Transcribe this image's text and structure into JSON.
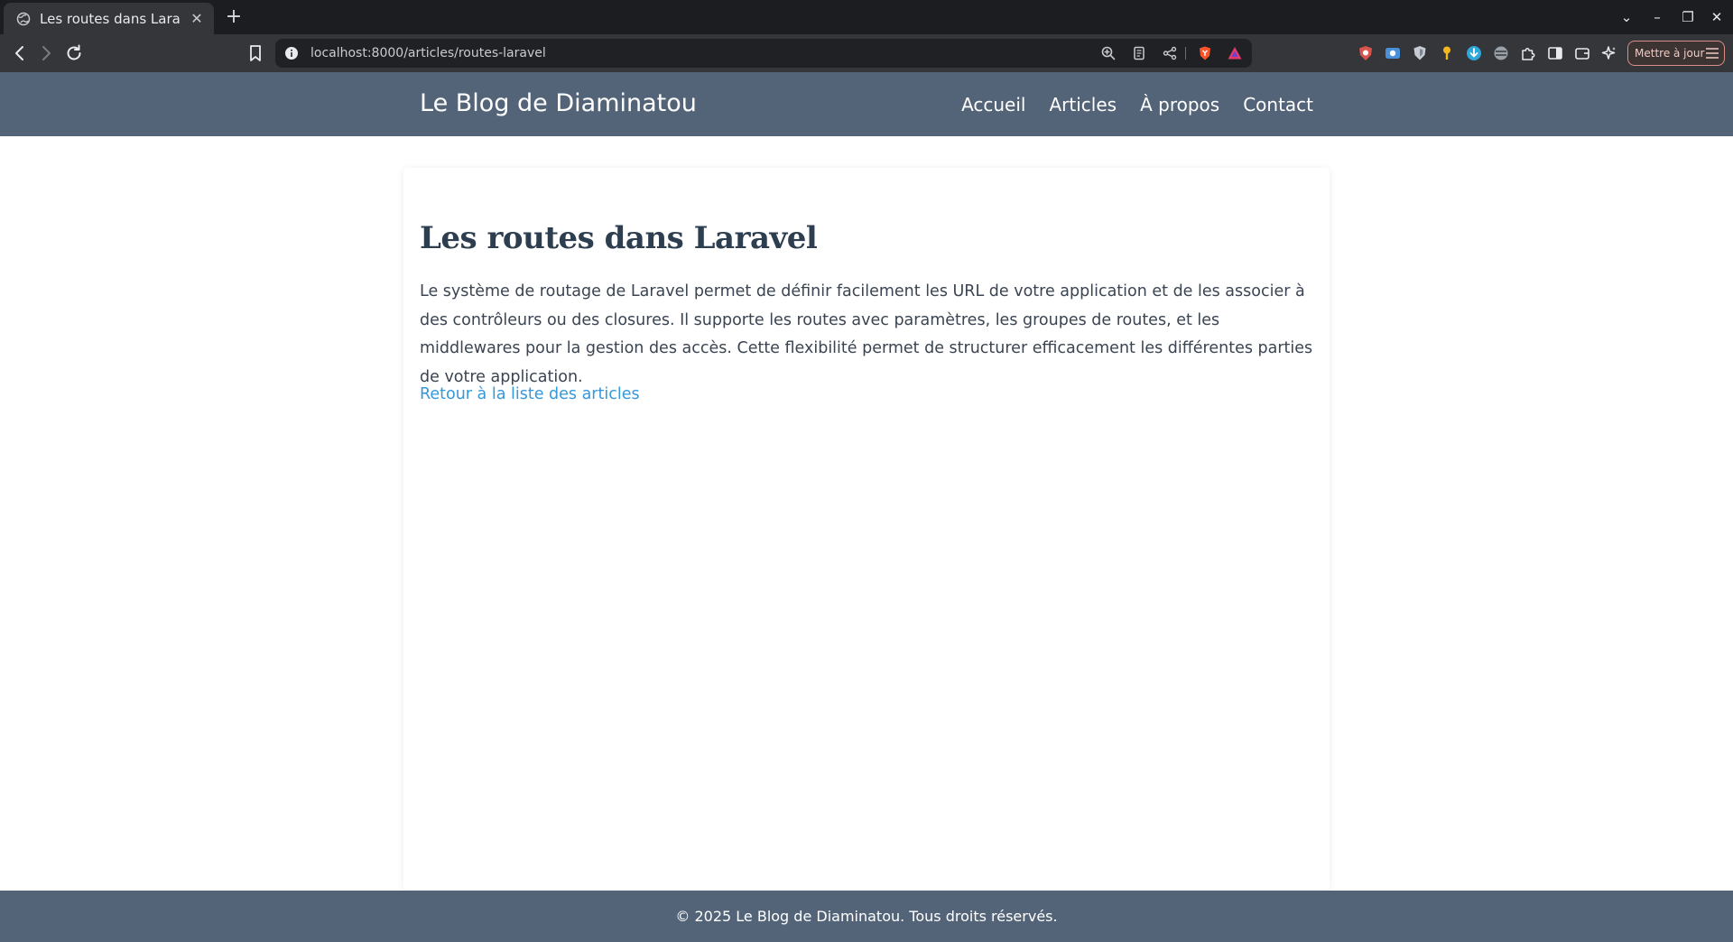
{
  "browser": {
    "tab": {
      "title": "Les routes dans Laravel",
      "close_glyph": "✕"
    },
    "new_tab_glyph": "+",
    "window_controls": {
      "list": "⌄",
      "minimize": "–",
      "restore": "❐",
      "close": "✕"
    },
    "url": "localhost:8000/articles/routes-laravel",
    "update_button": "Mettre à jour",
    "colors": {
      "tabbar": "#1c1d20",
      "toolbar": "#35363a",
      "urlbar": "#202124",
      "brave_orange": "#fb542b"
    }
  },
  "site": {
    "brand": "Le Blog de Diaminatou",
    "nav": [
      "Accueil",
      "Articles",
      "À propos",
      "Contact"
    ],
    "header_color": "#546478"
  },
  "article": {
    "title": "Les routes dans Laravel",
    "body": "Le système de routage de Laravel permet de définir facilement les URL de votre application et de les associer à des contrôleurs ou des closures. Il supporte les routes avec paramètres, les groupes de routes, et les middlewares pour la gestion des accès. Cette flexibilité permet de structurer efficacement les différentes parties de votre application.",
    "back_link": "Retour à la liste des articles",
    "link_color": "#3498db",
    "title_color": "#2c3e50"
  },
  "footer": {
    "text": "© 2025 Le Blog de Diaminatou. Tous droits réservés."
  }
}
